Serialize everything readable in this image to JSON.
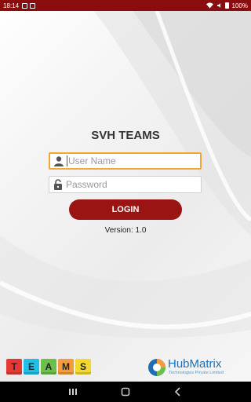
{
  "status_bar": {
    "time": "18:14",
    "battery": "100%"
  },
  "app": {
    "title": "SVH TEAMS",
    "username": {
      "placeholder": "User Name",
      "value": ""
    },
    "password": {
      "placeholder": "Password",
      "value": ""
    },
    "login_label": "LOGIN",
    "version": "Version: 1.0"
  },
  "footer": {
    "teams_letters": [
      "T",
      "E",
      "A",
      "M",
      "S"
    ],
    "teams_colors": [
      "#e53935",
      "#1ec0e8",
      "#6cc04a",
      "#f39c3c",
      "#f2d92c"
    ],
    "company_name": "HubMatrix",
    "company_tagline": "Technologies Private Limited"
  },
  "colors": {
    "status_bar": "#8b0c0c",
    "primary": "#9b1414",
    "focus_border": "#f0a830",
    "company_blue": "#1d6fb5"
  },
  "nav": {
    "icons": [
      "recents-icon",
      "home-icon",
      "back-icon"
    ]
  }
}
